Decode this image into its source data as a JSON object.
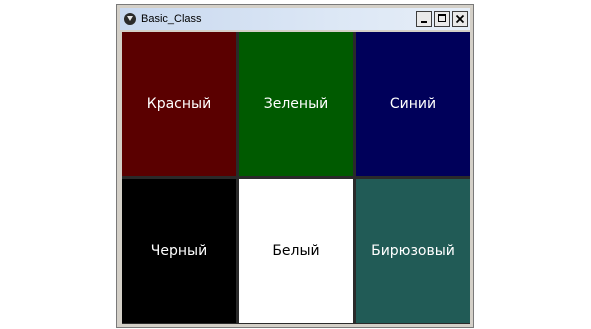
{
  "window": {
    "title": "Basic_Class"
  },
  "titlebar": {
    "icon": "kivy-app-icon",
    "buttons": [
      "minimize-icon",
      "maximize-icon",
      "close-icon"
    ]
  },
  "cells": [
    {
      "label": "Красный",
      "bg": "#5a0000",
      "fg": "#ffffff"
    },
    {
      "label": "Зеленый",
      "bg": "#005a00",
      "fg": "#ffffff"
    },
    {
      "label": "Синий",
      "bg": "#00005a",
      "fg": "#ffffff"
    },
    {
      "label": "Черный",
      "bg": "#000000",
      "fg": "#ffffff"
    },
    {
      "label": "Белый",
      "bg": "#ffffff",
      "fg": "#000000"
    },
    {
      "label": "Бирюзовый",
      "bg": "#215b56",
      "fg": "#ffffff"
    }
  ]
}
